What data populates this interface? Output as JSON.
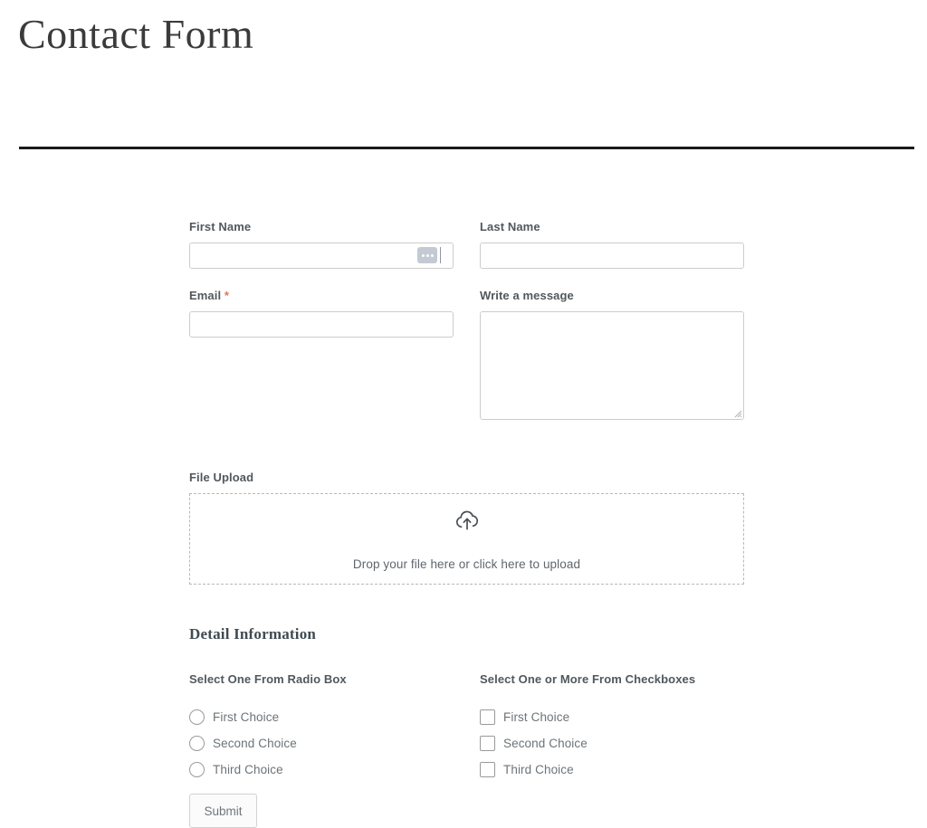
{
  "header": {
    "title": "Contact Form"
  },
  "form": {
    "fields": {
      "first_name": {
        "label": "First Name",
        "value": "",
        "placeholder": "",
        "badge_icon": "three-dots-autofill-icon"
      },
      "last_name": {
        "label": "Last Name",
        "value": "",
        "placeholder": ""
      },
      "email": {
        "label": "Email",
        "required_marker": "*",
        "value": "",
        "placeholder": ""
      },
      "message": {
        "label": "Write a message",
        "value": "",
        "placeholder": ""
      }
    },
    "upload": {
      "label": "File Upload",
      "icon": "cloud-upload-icon",
      "hint": "Drop your file here or click here to upload"
    },
    "detail": {
      "heading": "Detail Information",
      "radio_group": {
        "title": "Select One From Radio Box",
        "options": [
          {
            "label": "First Choice",
            "checked": false
          },
          {
            "label": "Second Choice",
            "checked": false
          },
          {
            "label": "Third Choice",
            "checked": false
          }
        ]
      },
      "checkbox_group": {
        "title": "Select One or More From Checkboxes",
        "options": [
          {
            "label": "First Choice",
            "checked": false
          },
          {
            "label": "Second Choice",
            "checked": false
          },
          {
            "label": "Third Choice",
            "checked": false
          }
        ]
      }
    },
    "submit": {
      "label": "Submit"
    }
  },
  "colors": {
    "label": "#50585e",
    "required_asterisk": "#e8705a",
    "rule": "#1a1a1a",
    "input_border": "#cccccc",
    "dashed_border": "#b9b9b9",
    "autofill_badge": "#c3cad3",
    "muted_text": "#6c7378"
  }
}
